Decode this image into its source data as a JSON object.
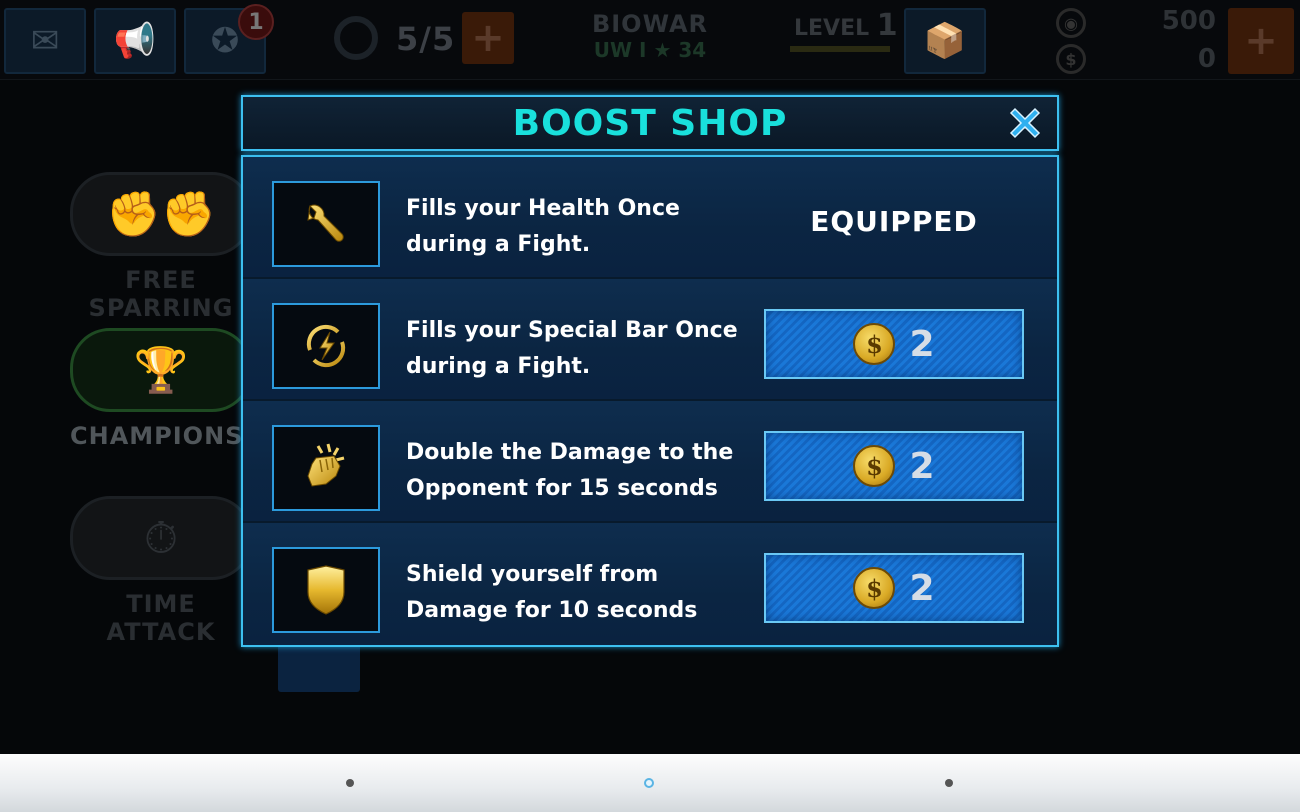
{
  "topbar": {
    "notification_count": "1",
    "energy": "5/5",
    "player_name": "BIOWAR",
    "player_sub": "UW I ★ 34",
    "level_label": "LEVEL",
    "level_value": "1",
    "gems": "500",
    "coins": "0"
  },
  "modes": [
    {
      "label": "FREE SPARRING"
    },
    {
      "label": "CHAMPIONSHIP"
    },
    {
      "label": "TIME ATTACK"
    }
  ],
  "modal": {
    "title": "BOOST SHOP",
    "items": [
      {
        "icon": "wrench-icon",
        "desc": "Fills your Health Once during a Fight.",
        "status": "EQUIPPED"
      },
      {
        "icon": "lightning-cycle-icon",
        "desc": "Fills your Special Bar Once during a Fight.",
        "price": "2",
        "currency_symbol": "$"
      },
      {
        "icon": "fist-icon",
        "desc": "Double the Damage to the Opponent for 15 seconds",
        "price": "2",
        "currency_symbol": "$"
      },
      {
        "icon": "shield-icon",
        "desc": "Shield yourself from Damage for 10 seconds",
        "price": "2",
        "currency_symbol": "$"
      }
    ]
  },
  "colors": {
    "title": "#19e0dc",
    "border": "#3dc0f0",
    "button": "#1a78d8",
    "coin": "#d9a925",
    "close": "#2fb0f0"
  }
}
